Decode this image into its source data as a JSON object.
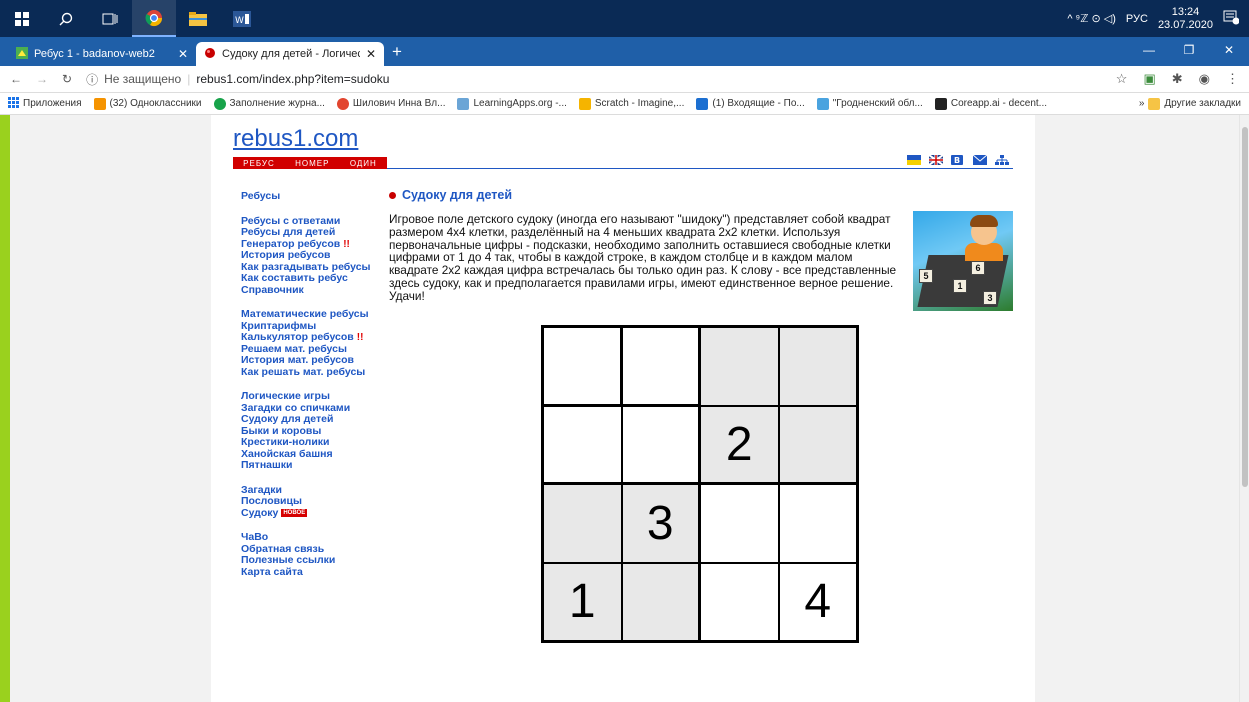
{
  "taskbar": {
    "clock_time": "13:24",
    "clock_date": "23.07.2020",
    "lang": "РУС",
    "tray": "^ ⁹ℤ ⊙ ◁)"
  },
  "browser": {
    "tabs": [
      {
        "label": "Ребус 1 - badanov-web2",
        "active": false
      },
      {
        "label": "Судоку для детей - Логические",
        "active": true
      }
    ],
    "security": "Не защищено",
    "url": "rebus1.com/index.php?item=sudoku",
    "bookmarks": [
      {
        "label": "Приложения",
        "color": "#1a73e8"
      },
      {
        "label": "(32) Одноклассники",
        "color": "#f59300"
      },
      {
        "label": "Заполнение журна...",
        "color": "#17a34a"
      },
      {
        "label": "Шилович Инна Вл...",
        "color": "#e2452f"
      },
      {
        "label": "LearningApps.org -...",
        "color": "#6ba5d6"
      },
      {
        "label": "Scratch - Imagine,...",
        "color": "#f5b400"
      },
      {
        "label": "(1) Входящие - По...",
        "color": "#1c6fd1"
      },
      {
        "label": "\"Гродненский обл...",
        "color": "#4aa3df"
      },
      {
        "label": "Coreapp.ai - decent...",
        "color": "#222222"
      }
    ],
    "other_bookmarks": "Другие закладки"
  },
  "site": {
    "logo": "rebus1.com",
    "logo_letter": "N",
    "strip": [
      "РЕБУС",
      "НОМЕР",
      "ОДИН"
    ]
  },
  "nav": [
    [
      {
        "label": "Ребусы"
      }
    ],
    [
      {
        "label": "Ребусы с ответами"
      },
      {
        "label": "Ребусы для детей"
      },
      {
        "label": "Генератор ребусов",
        "mark": "!!"
      },
      {
        "label": "История ребусов"
      },
      {
        "label": "Как разгадывать ребусы"
      },
      {
        "label": "Как составить ребус"
      },
      {
        "label": "Справочник"
      }
    ],
    [
      {
        "label": "Математические ребусы"
      },
      {
        "label": "Криптарифмы"
      },
      {
        "label": "Калькулятор ребусов",
        "mark": "!!"
      },
      {
        "label": "Решаем мат. ребусы"
      },
      {
        "label": "История мат. ребусов"
      },
      {
        "label": "Как решать мат. ребусы"
      }
    ],
    [
      {
        "label": "Логические игры"
      },
      {
        "label": "Загадки со спичками"
      },
      {
        "label": "Судоку для детей"
      },
      {
        "label": "Быки и коровы"
      },
      {
        "label": "Крестики-нолики"
      },
      {
        "label": "Ханойская башня"
      },
      {
        "label": "Пятнашки"
      }
    ],
    [
      {
        "label": "Загадки"
      },
      {
        "label": "Пословицы"
      },
      {
        "label": "Судоку",
        "badge": "НОВОЕ"
      }
    ],
    [
      {
        "label": "ЧаВо"
      },
      {
        "label": "Обратная связь"
      },
      {
        "label": "Полезные ссылки"
      },
      {
        "label": "Карта сайта"
      }
    ]
  ],
  "content": {
    "title": "Судоку для детей",
    "text": "Игровое поле детского судоку (иногда его называют \"шидоку\") представляет собой квадрат размером 4x4 клетки, разделённый на 4 меньших квадрата 2x2 клетки. Используя первоначальные цифры - подсказки, необходимо заполнить оставшиеся свободные клетки цифрами от 1 до 4 так, чтобы в каждой строке, в каждом столбце и в каждом малом квадрате 2x2 каждая цифра встречалась бы только один раз. К слову - все представленные здесь судоку, как и предполагается правилами игры, имеют единственное верное решение. Удачи!"
  },
  "sudoku": {
    "grid": [
      [
        "",
        "",
        "",
        ""
      ],
      [
        "",
        "",
        "2",
        ""
      ],
      [
        "",
        "3",
        "",
        ""
      ],
      [
        "1",
        "",
        "",
        "4"
      ]
    ]
  },
  "image_tiles": [
    "5",
    "6",
    "1",
    "3"
  ]
}
